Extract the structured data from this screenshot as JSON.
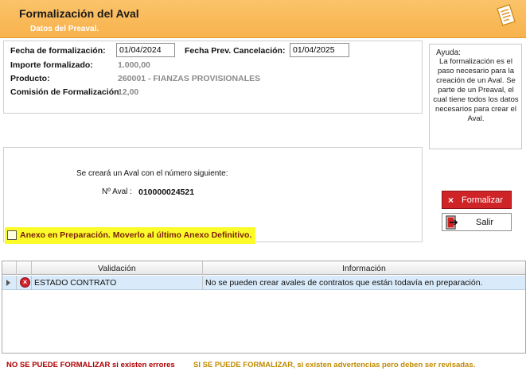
{
  "header": {
    "title": "Formalización del Aval",
    "subtitle": "Datos del Preaval."
  },
  "form": {
    "fecha_formalizacion_label": "Fecha de formalización:",
    "fecha_formalizacion_value": "01/04/2024",
    "fecha_cancelacion_label": "Fecha Prev. Cancelación:",
    "fecha_cancelacion_value": "01/04/2025",
    "importe_label": "Importe formalizado:",
    "importe_value": "1.000,00",
    "producto_label": "Producto:",
    "producto_value": "260001 - FIANZAS PROVISIONALES",
    "comision_label": "Comisión de Formalización:",
    "comision_value": "12,00"
  },
  "help": {
    "title": "Ayuda:",
    "text": "La formalización es el paso necesario para la creación de un Aval. Se parte de un Preaval, el cual tiene todos los datos necesarios para crear el Aval."
  },
  "aval": {
    "message": "Se creará un Aval con el número siguiente:",
    "number_label": "Nº Aval :",
    "number_value": "010000024521"
  },
  "anexo": {
    "label": "Anexo en Preparación. Moverlo al último Anexo Definitivo.",
    "checked": false
  },
  "buttons": {
    "formalizar": "Formalizar",
    "salir": "Salir"
  },
  "grid": {
    "columns": [
      "Validación",
      "Información"
    ],
    "rows": [
      {
        "status": "error",
        "validacion": "ESTADO CONTRATO",
        "informacion": "No se pueden crear avales de contratos que están todavía en preparación."
      }
    ]
  },
  "footer": {
    "error_text": "NO SE PUEDE FORMALIZAR si existen errores",
    "warning_text": "SI SE PUEDE FORMALIZAR, si existen advertencias pero deben ser revisadas."
  },
  "colors": {
    "header": "#f8b24c",
    "error": "#b00000",
    "warning": "#c08b00",
    "highlight": "#fbfb2a"
  }
}
